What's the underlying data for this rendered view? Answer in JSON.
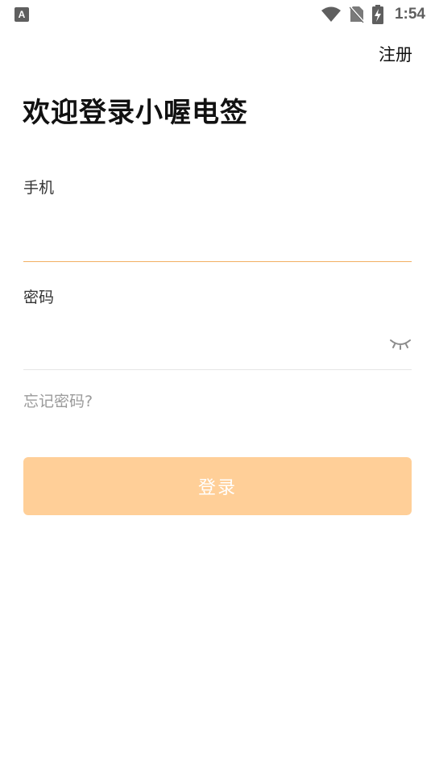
{
  "status_bar": {
    "left_icon": "keyboard-a-icon",
    "left_icon_text": "A",
    "icons": [
      "wifi-icon",
      "no-sim-icon",
      "battery-charging-icon"
    ],
    "time": "1:54"
  },
  "header": {
    "register_label": "注册"
  },
  "title": "欢迎登录小喔电签",
  "form": {
    "phone": {
      "label": "手机",
      "value": "",
      "placeholder": ""
    },
    "password": {
      "label": "密码",
      "value": "",
      "placeholder": "",
      "visibility_icon": "eye-closed-icon"
    },
    "forgot_label": "忘记密码?",
    "login_label": "登录"
  },
  "colors": {
    "accent_line": "#f2b063",
    "button_bg": "#ffcf98",
    "muted_text": "#9a9a9a",
    "divider": "#e6e6e6"
  }
}
